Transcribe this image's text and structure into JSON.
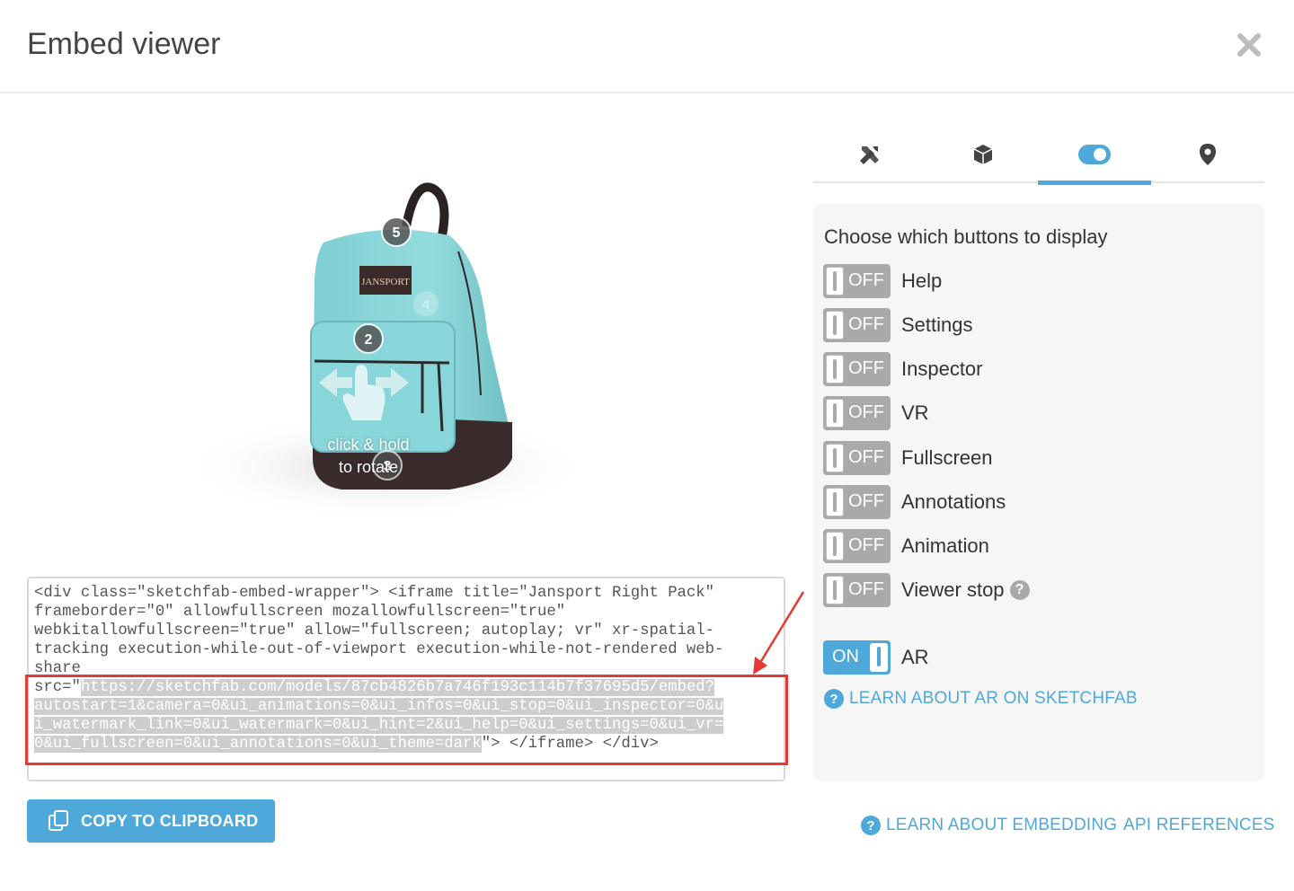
{
  "dialog": {
    "title": "Embed viewer"
  },
  "viewer": {
    "hint_line1": "click & hold",
    "hint_line2": "to rotate",
    "annotations": [
      "5",
      "4",
      "2",
      "3"
    ],
    "brand_patch": "JANSPORT"
  },
  "code": {
    "lines_plain": [
      "<div class=\"sketchfab-embed-wrapper\"> <iframe title=\"Jansport Right Pack\"",
      "frameborder=\"0\" allowfullscreen mozallowfullscreen=\"true\"",
      "webkitallowfullscreen=\"true\" allow=\"fullscreen; autoplay; vr\" xr-spatial-",
      "tracking execution-while-out-of-viewport execution-while-not-rendered web-",
      "share"
    ],
    "line6_prefix": "src=\"",
    "line6_sel": "https://sketchfab.com/models/87cb4826b7a746f193c114b7f37695d5/embed?",
    "line7_sel": "autostart=1&camera=0&ui_animations=0&ui_infos=0&ui_stop=0&ui_inspector=0&u",
    "line8_sel": "i_watermark_link=0&ui_watermark=0&ui_hint=2&ui_help=0&ui_settings=0&ui_vr=",
    "line9_sel": "0&ui_fullscreen=0&ui_annotations=0&ui_theme=dark",
    "line9_suffix": "\"> </iframe> </div>"
  },
  "copy_button": {
    "label": "COPY TO CLIPBOARD"
  },
  "tabs": [
    {
      "icon": "tools-icon"
    },
    {
      "icon": "cube-icon"
    },
    {
      "icon": "toggle-icon",
      "active": true
    },
    {
      "icon": "location-pin-icon"
    }
  ],
  "panel": {
    "title": "Choose which buttons to display",
    "off_text": "OFF",
    "on_text": "ON",
    "options": [
      {
        "label": "Help",
        "state": "OFF"
      },
      {
        "label": "Settings",
        "state": "OFF"
      },
      {
        "label": "Inspector",
        "state": "OFF"
      },
      {
        "label": "VR",
        "state": "OFF"
      },
      {
        "label": "Fullscreen",
        "state": "OFF"
      },
      {
        "label": "Annotations",
        "state": "OFF"
      },
      {
        "label": "Animation",
        "state": "OFF"
      },
      {
        "label": "Viewer stop",
        "state": "OFF"
      }
    ],
    "ar": {
      "label": "AR",
      "state": "ON"
    },
    "help_glyph": "?",
    "ar_link": "LEARN ABOUT AR ON SKETCHFAB"
  },
  "footer": {
    "embedding_link": "LEARN ABOUT EMBEDDING",
    "api_link": "API REFERENCES"
  },
  "colors": {
    "accent": "#4ea8da",
    "highlight": "#e53935",
    "toggle_off": "#a9a9a9"
  }
}
